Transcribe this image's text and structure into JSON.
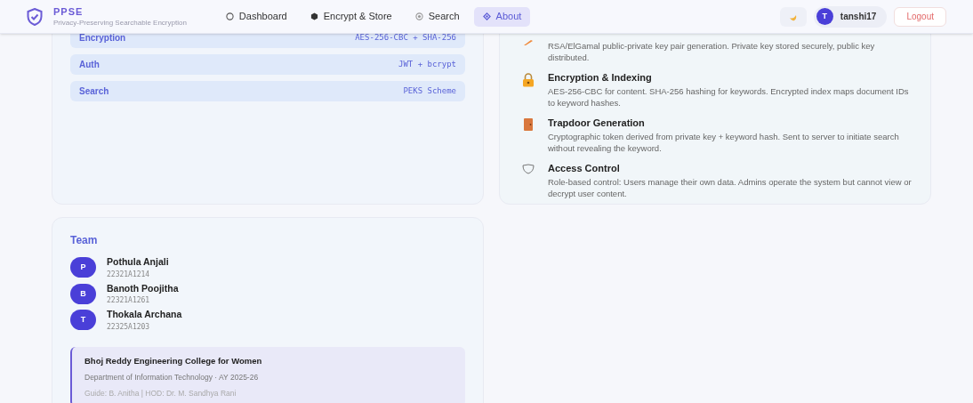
{
  "brand": {
    "title": "PPSE",
    "subtitle": "Privacy-Preserving Searchable Encryption"
  },
  "nav": [
    {
      "label": "Dashboard",
      "kind": "circle",
      "selected": false
    },
    {
      "label": "Encrypt & Store",
      "kind": "hexagon",
      "selected": false
    },
    {
      "label": "Search",
      "kind": "target",
      "selected": false
    },
    {
      "label": "About",
      "kind": "diamond",
      "selected": true
    }
  ],
  "user": {
    "initial": "T",
    "name": "tanshi17"
  },
  "logout": "Logout",
  "stack": [
    {
      "label": "Encryption",
      "value": "AES-256-CBC + SHA-256"
    },
    {
      "label": "Auth",
      "value": "JWT + bcrypt"
    },
    {
      "label": "Search",
      "value": "PEKS Scheme"
    }
  ],
  "features": [
    {
      "kind": "key",
      "description": "RSA/ElGamal public-private key pair generation. Private key stored securely, public key distributed."
    },
    {
      "kind": "lock",
      "title": "Encryption & Indexing",
      "description": "AES-256-CBC for content. SHA-256 hashing for keywords. Encrypted index maps document IDs to keyword hashes."
    },
    {
      "kind": "door",
      "title": "Trapdoor Generation",
      "description": "Cryptographic token derived from private key + keyword hash. Sent to server to initiate search without revealing the keyword."
    },
    {
      "kind": "shield",
      "title": "Access Control",
      "description": "Role-based control: Users manage their own data. Admins operate the system but cannot view or decrypt user content."
    }
  ],
  "team": {
    "title": "Team",
    "members": [
      {
        "initial": "P",
        "name": "Pothula Anjali",
        "id": "22321A1214"
      },
      {
        "initial": "B",
        "name": "Banoth Poojitha",
        "id": "22321A1261"
      },
      {
        "initial": "T",
        "name": "Thokala Archana",
        "id": "22325A1203"
      }
    ],
    "college": {
      "name": "Bhoj Reddy Engineering College for Women",
      "department": "Department of Information Technology · AY 2025-26",
      "guide": "Guide: B. Anitha | HOD: Dr. M. Sandhya Rani"
    }
  }
}
